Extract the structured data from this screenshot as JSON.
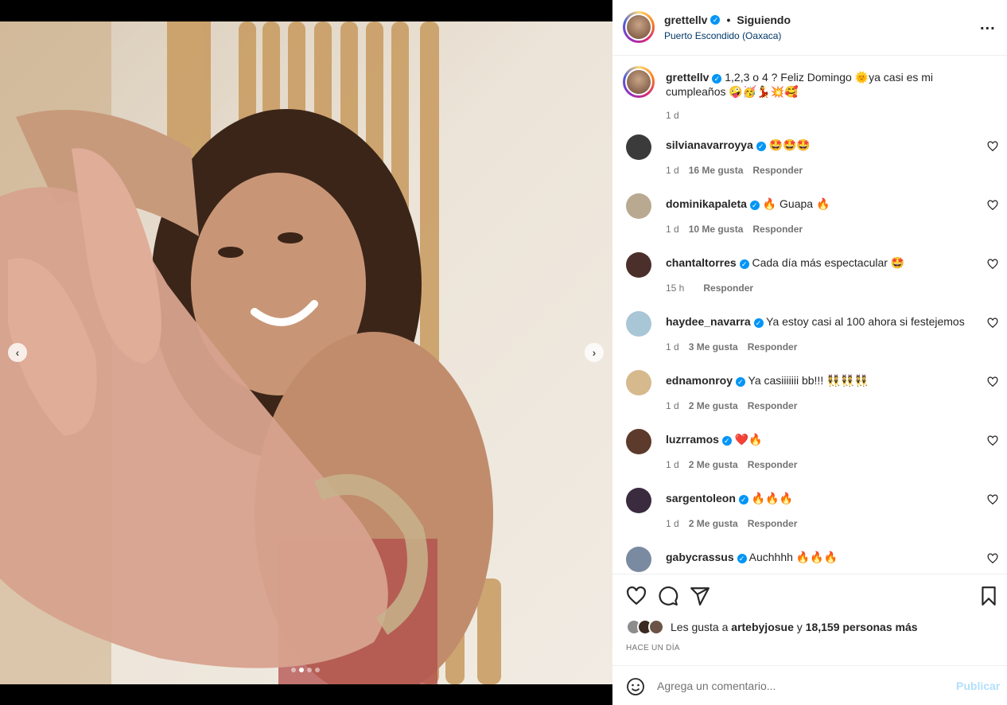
{
  "header": {
    "username": "grettellv",
    "separator": "•",
    "follow_status": "Siguiendo",
    "location": "Puerto Escondido (Oaxaca)",
    "more_label": "..."
  },
  "media": {
    "prev_label": "‹",
    "next_label": "›",
    "carousel_count": 4,
    "carousel_active_index": 1
  },
  "caption": {
    "username": "grettellv",
    "text": "1,2,3 o 4 ? Feliz Domingo 🌞ya casi es mi cumpleaños 🤪🥳💃💥🥰",
    "time": "1 d"
  },
  "comments": [
    {
      "username": "silvianavarroyya",
      "text": "🤩🤩🤩",
      "time": "1 d",
      "likes": "16 Me gusta",
      "reply": "Responder",
      "avatar_color": "#3b3b3b"
    },
    {
      "username": "dominikapaleta",
      "text": "🔥 Guapa 🔥",
      "time": "1 d",
      "likes": "10 Me gusta",
      "reply": "Responder",
      "avatar_color": "#b9a991"
    },
    {
      "username": "chantaltorres",
      "text": "Cada día más espectacular 🤩",
      "time": "15 h",
      "likes": "",
      "reply": "Responder",
      "avatar_color": "#4a2f2a"
    },
    {
      "username": "haydee_navarra",
      "text": "Ya estoy casi al 100 ahora si festejemos",
      "time": "1 d",
      "likes": "3 Me gusta",
      "reply": "Responder",
      "avatar_color": "#a9c6d6"
    },
    {
      "username": "ednamonroy",
      "text": "Ya casiiiiiii bb!!! 👯👯👯",
      "time": "1 d",
      "likes": "2 Me gusta",
      "reply": "Responder",
      "avatar_color": "#d7b98e"
    },
    {
      "username": "luzrramos",
      "text": "❤️🔥",
      "time": "1 d",
      "likes": "2 Me gusta",
      "reply": "Responder",
      "avatar_color": "#5c3a2c"
    },
    {
      "username": "sargentoleon",
      "text": "🔥🔥🔥",
      "time": "1 d",
      "likes": "2 Me gusta",
      "reply": "Responder",
      "avatar_color": "#3a2b3f"
    },
    {
      "username": "gabycrassus",
      "text": "Auchhhh 🔥🔥🔥",
      "time": "",
      "likes": "",
      "reply": "",
      "avatar_color": "#7a8aa0"
    }
  ],
  "likes": {
    "prefix": "Les gusta a",
    "first_user": "artebyjosue",
    "connector": "y",
    "others": "18,159 personas más"
  },
  "time_ago": "HACE UN DÍA",
  "add_comment": {
    "placeholder": "Agrega un comentario...",
    "publish_label": "Publicar"
  },
  "colors": {
    "verified": "#0095f6",
    "link": "#00376b",
    "muted": "#737373",
    "publish_disabled": "#b2dffc"
  }
}
